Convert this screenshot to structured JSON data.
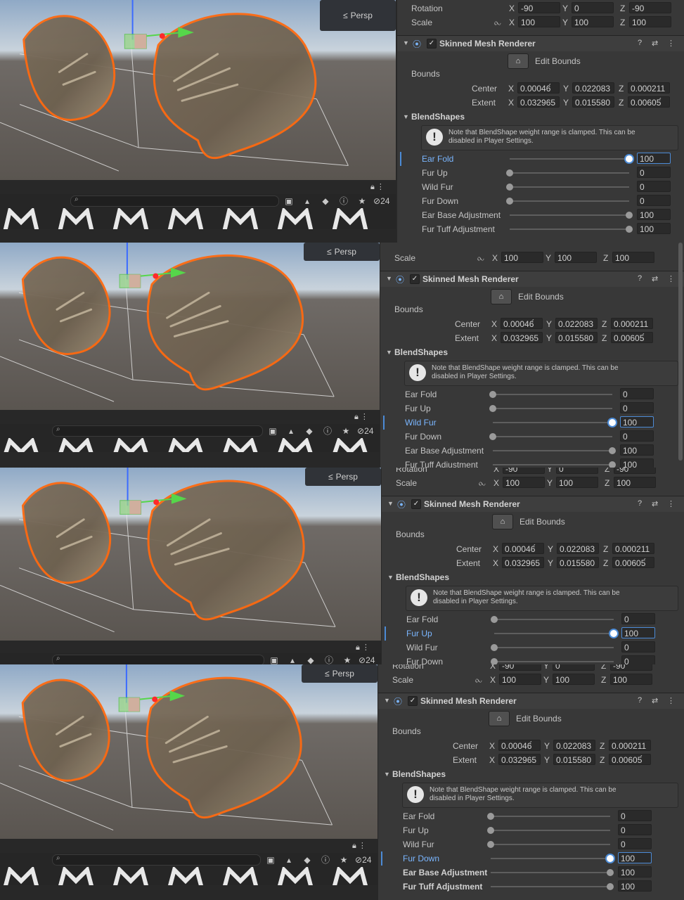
{
  "scene": {
    "persp_label": "Persp",
    "search_placeholder": "",
    "hidden_count": "24"
  },
  "inspector": {
    "rotation_label": "Rotation",
    "scale_label": "Scale",
    "rotation": {
      "x": "-90",
      "y": "0",
      "z": "-90"
    },
    "scale": {
      "x": "100",
      "y": "100",
      "z": "100"
    },
    "component_title": "Skinned Mesh Renderer",
    "edit_bounds_label": "Edit Bounds",
    "bounds_label": "Bounds",
    "center_label": "Center",
    "extent_label": "Extent",
    "center": {
      "x": "0.00046́",
      "y": "0.022083",
      "z": "0.000211"
    },
    "extent": {
      "x": "0.032965",
      "y": "0.015580",
      "z": "0.00605́"
    },
    "axis_labels": {
      "x": "X",
      "y": "Y",
      "z": "Z"
    },
    "blendshapes_label": "BlendShapes",
    "note_line1": "Note that BlendShape weight range is clamped. This can be",
    "note_line2": "disabled in Player Settings."
  },
  "states": [
    {
      "active": "Ear Fold",
      "blendshapes": [
        {
          "name": "Ear Fold",
          "value": "100",
          "fraction": 1.0
        },
        {
          "name": "Fur Up",
          "value": "0",
          "fraction": 0.0
        },
        {
          "name": "Wild Fur",
          "value": "0",
          "fraction": 0.0
        },
        {
          "name": "Fur Down",
          "value": "0",
          "fraction": 0.0
        },
        {
          "name": "Ear Base Adjustment",
          "value": "100",
          "fraction": 1.0
        },
        {
          "name": "Fur Tuff Adjustment",
          "value": "100",
          "fraction": 1.0
        }
      ]
    },
    {
      "active": "Wild Fur",
      "blendshapes": [
        {
          "name": "Ear Fold",
          "value": "0",
          "fraction": 0.0
        },
        {
          "name": "Fur Up",
          "value": "0",
          "fraction": 0.0
        },
        {
          "name": "Wild Fur",
          "value": "100",
          "fraction": 1.0
        },
        {
          "name": "Fur Down",
          "value": "0",
          "fraction": 0.0
        },
        {
          "name": "Ear Base Adjustment",
          "value": "100",
          "fraction": 1.0
        },
        {
          "name": "Fur Tuff Adjustment",
          "value": "100",
          "fraction": 1.0
        }
      ]
    },
    {
      "active": "Fur Up",
      "blendshapes": [
        {
          "name": "Ear Fold",
          "value": "0",
          "fraction": 0.0
        },
        {
          "name": "Fur Up",
          "value": "100",
          "fraction": 1.0
        },
        {
          "name": "Wild Fur",
          "value": "0",
          "fraction": 0.0
        },
        {
          "name": "Fur Down",
          "value": "0",
          "fraction": 0.0
        }
      ]
    },
    {
      "active": "Fur Down",
      "blendshapes": [
        {
          "name": "Ear Fold",
          "value": "0",
          "fraction": 0.0
        },
        {
          "name": "Fur Up",
          "value": "0",
          "fraction": 0.0
        },
        {
          "name": "Wild Fur",
          "value": "0",
          "fraction": 0.0
        },
        {
          "name": "Fur Down",
          "value": "100",
          "fraction": 1.0
        },
        {
          "name": "Ear Base Adjustment",
          "value": "100",
          "fraction": 1.0
        },
        {
          "name": "Fur Tuff Adjustment",
          "value": "100",
          "fraction": 1.0
        }
      ]
    }
  ],
  "icons": {
    "edit_bounds": "bounds-icon",
    "component": "skinned-mesh-icon",
    "warning": "exclamation-icon",
    "help": "help-icon",
    "presets": "presets-icon",
    "menu": "kebab-icon"
  }
}
